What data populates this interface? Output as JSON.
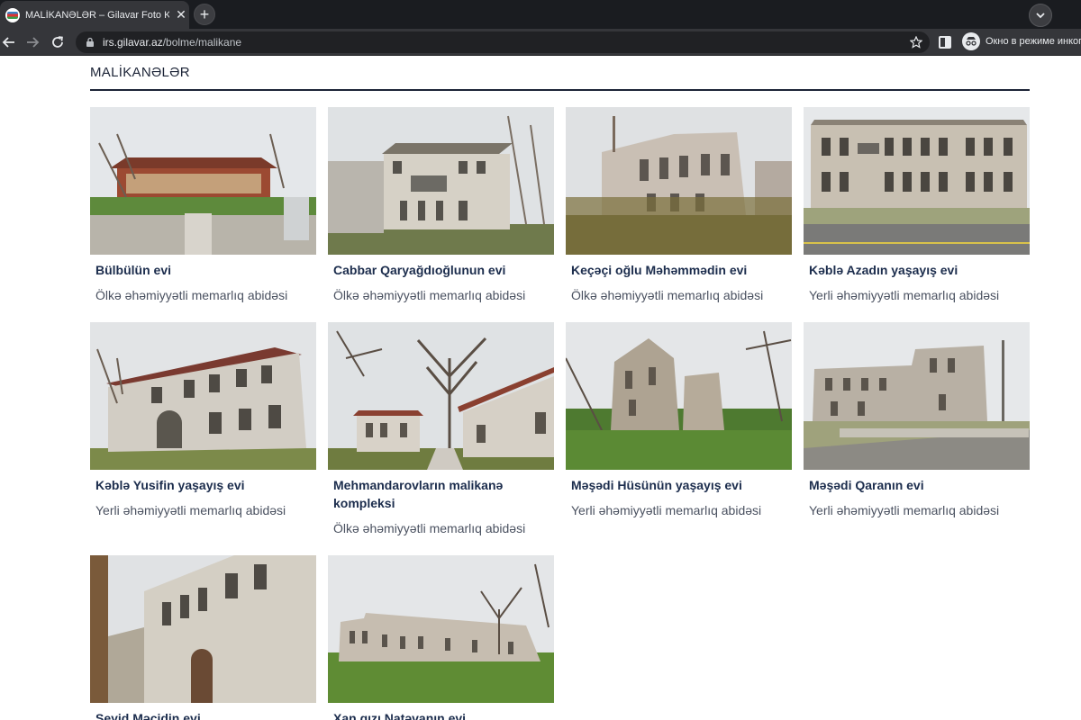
{
  "browser": {
    "tab_title": "MALİKANƏLƏR – Gilavar Foto Klub",
    "close_glyph": "✕",
    "new_tab_glyph": "+",
    "url_host": "irs.gilavar.az",
    "url_path": "/bolme/malikane",
    "incognito_label": "Окно в режиме инкогнито"
  },
  "page": {
    "section_title": "MALİKANƏLƏR"
  },
  "cards": [
    {
      "title": "Bülbülün evi",
      "subtitle": "Ölkə əhəmiyyətli memarlıq abidəsi"
    },
    {
      "title": "Cabbar Qaryağdıoğlunun evi",
      "subtitle": "Ölkə əhəmiyyətli memarlıq abidəsi"
    },
    {
      "title": "Keçəçi oğlu Məhəmmədin evi",
      "subtitle": "Ölkə əhəmiyyətli memarlıq abidəsi"
    },
    {
      "title": "Kəblə Azadın yaşayış evi",
      "subtitle": "Yerli əhəmiyyətli memarlıq abidəsi"
    },
    {
      "title": "Kəblə Yusifin yaşayış evi",
      "subtitle": "Yerli əhəmiyyətli memarlıq abidəsi"
    },
    {
      "title": "Mehmandarovların malikanə kompleksi",
      "subtitle": "Ölkə əhəmiyyətli memarlıq abidəsi"
    },
    {
      "title": "Məşədi Hüsünün yaşayış evi",
      "subtitle": "Yerli əhəmiyyətli memarlıq abidəsi"
    },
    {
      "title": "Məşədi Qaranın evi",
      "subtitle": "Yerli əhəmiyyətli memarlıq abidəsi"
    },
    {
      "title": "Seyid Məcidin evi",
      "subtitle": ""
    },
    {
      "title": "Xan qızı Natəvanın evi",
      "subtitle": ""
    }
  ],
  "colors": {
    "title_text": "#1c2d4d",
    "subtitle_text": "#4a5160",
    "rule": "#1c2437"
  }
}
